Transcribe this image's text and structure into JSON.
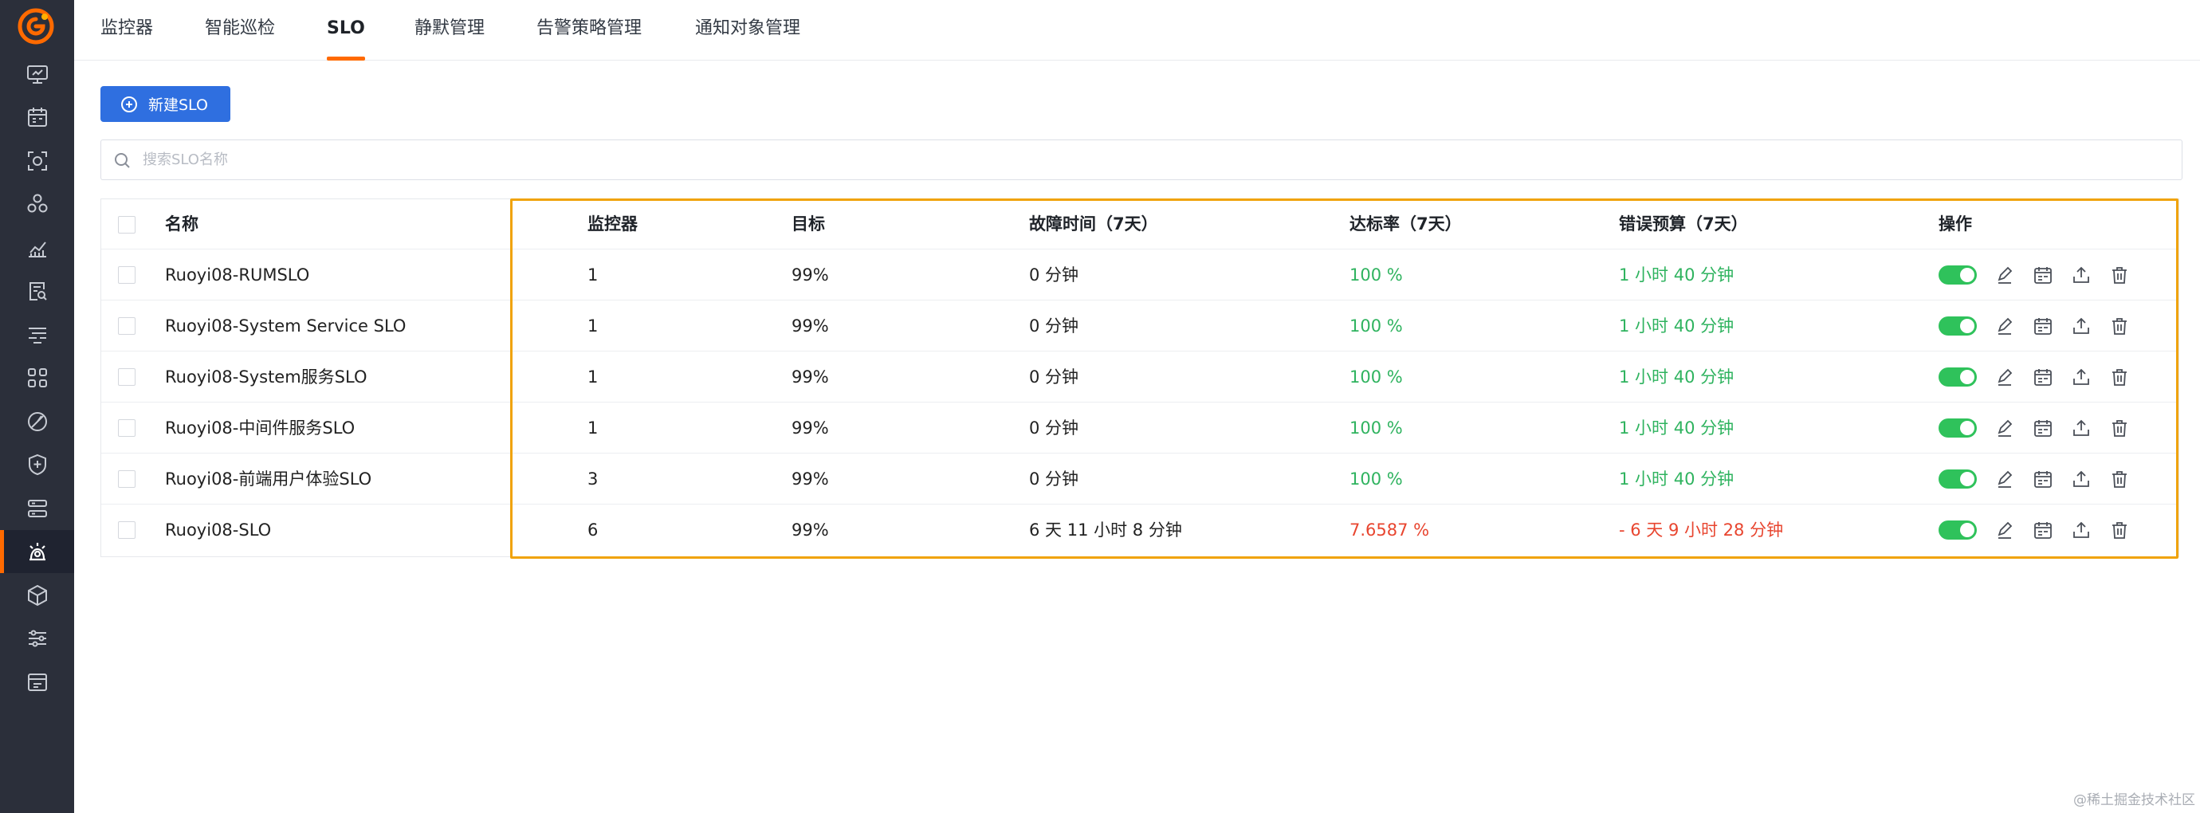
{
  "sidebar": {
    "logo_icon": "guance-logo",
    "items": [
      {
        "icon": "monitor-screen-icon"
      },
      {
        "icon": "calendar-icon"
      },
      {
        "icon": "scan-icon"
      },
      {
        "icon": "cluster-icon"
      },
      {
        "icon": "metrics-chart-icon"
      },
      {
        "icon": "log-search-icon"
      },
      {
        "icon": "filter-lines-icon"
      },
      {
        "icon": "apps-grid-icon"
      },
      {
        "icon": "gauge-icon"
      },
      {
        "icon": "shield-plus-icon"
      },
      {
        "icon": "server-icon"
      },
      {
        "icon": "monitoring-alarm-icon",
        "active": true
      },
      {
        "icon": "cube-icon"
      },
      {
        "icon": "sliders-icon"
      },
      {
        "icon": "inbox-icon"
      }
    ]
  },
  "tabs": [
    {
      "label": "监控器"
    },
    {
      "label": "智能巡检"
    },
    {
      "label": "SLO",
      "active": true
    },
    {
      "label": "静默管理"
    },
    {
      "label": "告警策略管理"
    },
    {
      "label": "通知对象管理"
    }
  ],
  "toolbar": {
    "new_label": "新建SLO"
  },
  "search": {
    "placeholder": "搜索SLO名称",
    "value": ""
  },
  "table": {
    "columns": [
      "名称",
      "监控器",
      "目标",
      "故障时间（7天）",
      "达标率（7天）",
      "错误预算（7天）",
      "操作"
    ],
    "rows": [
      {
        "name": "Ruoyi08-RUMSLO",
        "monitors": "1",
        "target": "99%",
        "downtime": "0 分钟",
        "rate": "100 %",
        "budget": "1 小时 40 分钟",
        "status": "ok",
        "enabled": true
      },
      {
        "name": "Ruoyi08-System Service SLO",
        "monitors": "1",
        "target": "99%",
        "downtime": "0 分钟",
        "rate": "100 %",
        "budget": "1 小时 40 分钟",
        "status": "ok",
        "enabled": true
      },
      {
        "name": "Ruoyi08-System服务SLO",
        "monitors": "1",
        "target": "99%",
        "downtime": "0 分钟",
        "rate": "100 %",
        "budget": "1 小时 40 分钟",
        "status": "ok",
        "enabled": true
      },
      {
        "name": "Ruoyi08-中间件服务SLO",
        "monitors": "1",
        "target": "99%",
        "downtime": "0 分钟",
        "rate": "100 %",
        "budget": "1 小时 40 分钟",
        "status": "ok",
        "enabled": true
      },
      {
        "name": "Ruoyi08-前端用户体验SLO",
        "monitors": "3",
        "target": "99%",
        "downtime": "0 分钟",
        "rate": "100 %",
        "budget": "1 小时 40 分钟",
        "status": "ok",
        "enabled": true
      },
      {
        "name": "Ruoyi08-SLO",
        "monitors": "6",
        "target": "99%",
        "downtime": "6 天 11 小时 8 分钟",
        "rate": "7.6587 %",
        "budget": "- 6 天 9 小时 28 分钟",
        "status": "bad",
        "enabled": true
      }
    ]
  },
  "colors": {
    "accent": "#ff6a00",
    "primary": "#2f6fe0",
    "ok": "#2fb35f",
    "bad": "#e8452f",
    "highlight": "#f0a30a"
  },
  "watermark": "@稀土掘金技术社区"
}
